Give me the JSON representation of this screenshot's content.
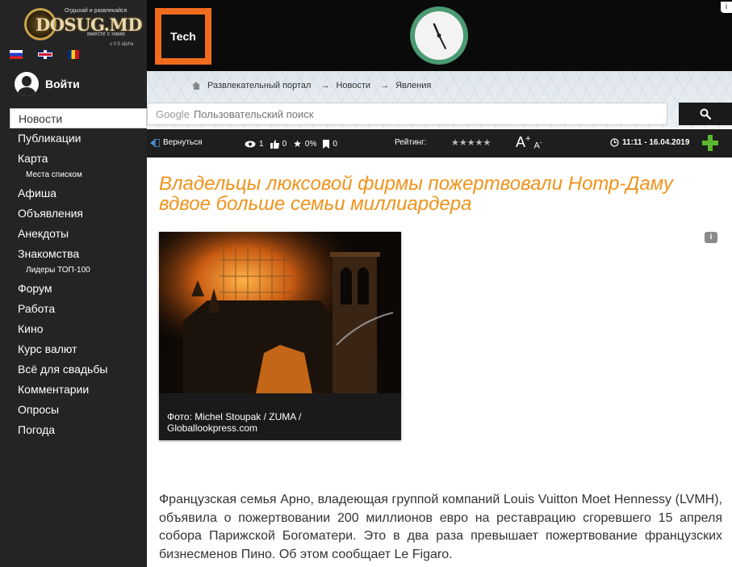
{
  "site": {
    "tagline": "Отдыхай и развлекайся",
    "logo_text": "DOSUG.MD",
    "logo_sub": "вместе с нами",
    "version": "v 0.5 alpha"
  },
  "login_label": "Войти",
  "nav": {
    "active": "Новости",
    "items": [
      "Публикации",
      "Карта",
      "Места списком",
      "Афиша",
      "Объявления",
      "Анекдоты",
      "Знакомства",
      "Лидеры ТОП-100",
      "Форум",
      "Работа",
      "Кино",
      "Курс валют",
      "Всё для свадьбы",
      "Комментарии",
      "Опросы",
      "Погода"
    ]
  },
  "banner": {
    "ad_label": "Tech",
    "close": "i"
  },
  "breadcrumb": [
    "Развлекательный портал",
    "Новости",
    "Явления"
  ],
  "search": {
    "brand": "Google",
    "placeholder": "Пользовательский поиск"
  },
  "toolbar": {
    "back": "Вернуться",
    "views": "1",
    "likes": "0",
    "rating_pct": "0%",
    "bookmarks": "0",
    "rating_label": "Рейтинг:",
    "stars": "★★★★★",
    "font_big": "A",
    "font_small": "A",
    "datetime": "11:11 - 16.04.2019"
  },
  "article": {
    "title": "Владельцы люксовой фирмы пожертвовали Нотр-Даму вдвое больше семьи миллиардера",
    "photo_caption": "Фото: Michel Stoupak / ZUMA / Globallookpress.com",
    "body": "Французская семья Арно, владеющая группой компаний Louis Vuitton Moet Hennessy (LVMH), объявила о пожертвовании 200 миллионов евро на реставрацию сгоревшего 15 апреля собора Парижской Богоматери. Это в два раза превышает пожертвование французских бизнесменов Пино. Об этом сообщает Le Figaro."
  },
  "colors": {
    "accent": "#f0931b",
    "sidebar": "#242424",
    "toolbar": "#1e1e1e",
    "plus": "#5bb82e"
  },
  "icons": [
    "back-icon",
    "eye-icon",
    "thumb-up-icon",
    "star-icon",
    "bookmark-icon",
    "clock-icon",
    "search-icon",
    "home-icon",
    "info-icon",
    "plus-icon"
  ]
}
